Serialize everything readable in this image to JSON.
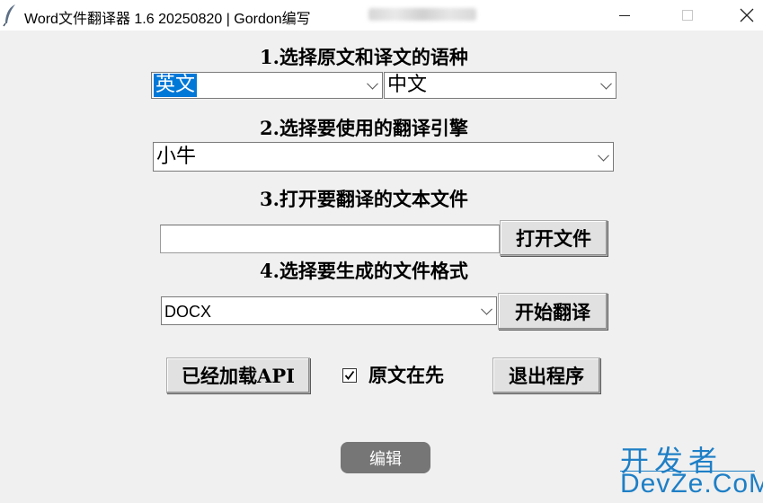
{
  "window": {
    "title": "Word文件翻译器 1.6  20250820 | Gordon编写"
  },
  "section1": {
    "label": "1.选择原文和译文的语种",
    "source_lang": "英文",
    "target_lang": "中文"
  },
  "section2": {
    "label": "2.选择要使用的翻译引擎",
    "engine": "小牛"
  },
  "section3": {
    "label": "3.打开要翻译的文本文件",
    "file_path": "",
    "open_button": "打开文件"
  },
  "section4": {
    "label": "4.选择要生成的文件格式",
    "format": "DOCX",
    "start_button": "开始翻译"
  },
  "bottom": {
    "api_button": "已经加载API",
    "checkbox_label": "原文在先",
    "checkbox_checked": true,
    "exit_button": "退出程序"
  },
  "overlay": {
    "edit_label": "编辑"
  },
  "watermark": {
    "line1": "开发者",
    "line2": "DevZe.CoM"
  },
  "colors": {
    "selection": "#0078d7",
    "watermark": "#1e7fc6"
  }
}
